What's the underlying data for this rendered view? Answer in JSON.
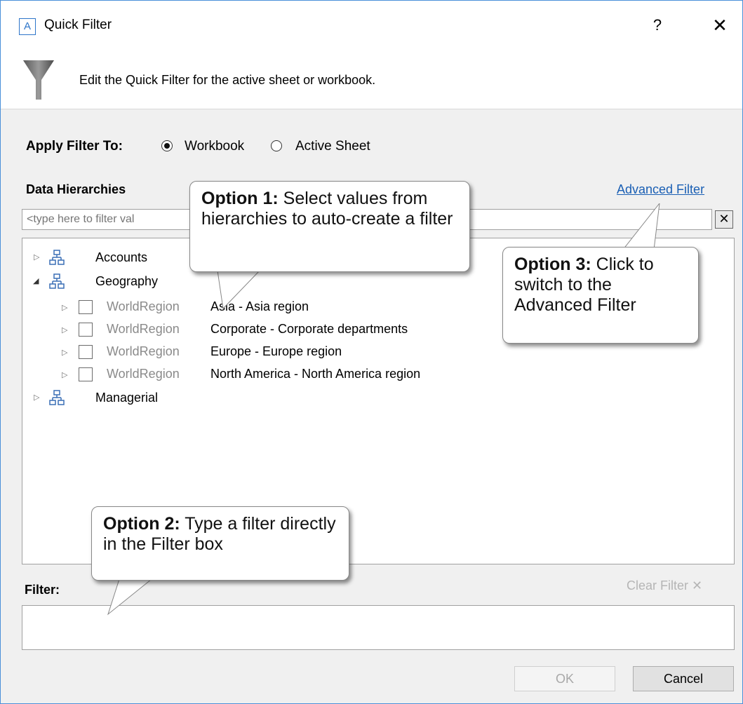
{
  "window": {
    "app_icon_letter": "A",
    "title": "Quick Filter",
    "help_label": "?",
    "close_label": "✕"
  },
  "header": {
    "icon": "funnel-icon",
    "subtitle": "Edit the Quick Filter for the active sheet or workbook."
  },
  "apply": {
    "label": "Apply Filter To:",
    "options": [
      {
        "label": "Workbook",
        "selected": true
      },
      {
        "label": "Active Sheet",
        "selected": false
      }
    ]
  },
  "hierarchies": {
    "label": "Data Hierarchies",
    "advanced_link": "Advanced Filter",
    "search_placeholder": "<type here to filter val",
    "clear_search": "✕",
    "tree": [
      {
        "label": "Accounts",
        "expanded": false
      },
      {
        "label": "Geography",
        "expanded": true,
        "children": [
          {
            "level": "WorldRegion",
            "member": "Asia - Asia region"
          },
          {
            "level": "WorldRegion",
            "member": "Corporate - Corporate departments"
          },
          {
            "level": "WorldRegion",
            "member": "Europe - Europe region"
          },
          {
            "level": "WorldRegion",
            "member": "North America - North America region"
          }
        ]
      },
      {
        "label": "Managerial",
        "expanded": false
      }
    ]
  },
  "filter": {
    "label": "Filter:",
    "clear_label": "Clear Filter ✕",
    "value": ""
  },
  "buttons": {
    "ok": "OK",
    "cancel": "Cancel"
  },
  "callouts": {
    "option1_title": "Option 1:",
    "option1_text": " Select values from hierarchies to auto-create a filter",
    "option2_title": "Option 2:",
    "option2_text": " Type a filter directly in the Filter box",
    "option3_title": "Option 3:",
    "option3_text": " Click to switch to the Advanced Filter"
  },
  "colors": {
    "accent": "#2e75c9",
    "link": "#1a5fb4",
    "hierarchy_icon": "#3a6fb5"
  }
}
